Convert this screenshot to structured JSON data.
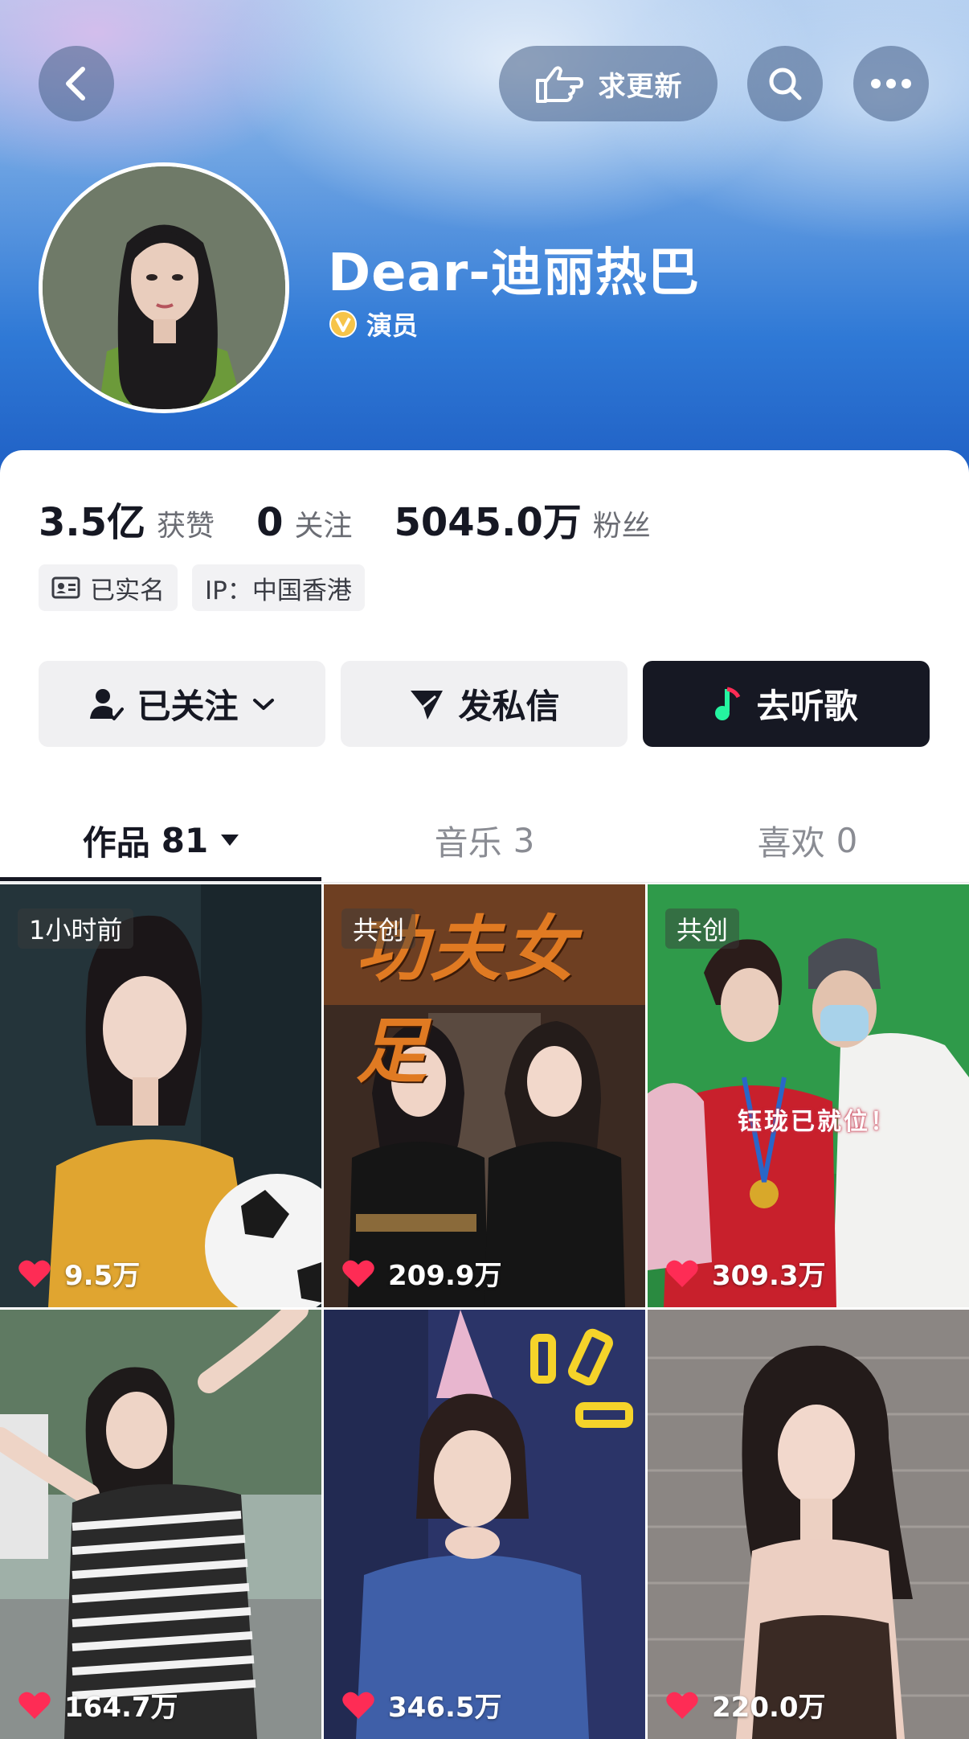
{
  "topbar": {
    "update_label": "求更新"
  },
  "profile": {
    "username": "Dear-迪丽热巴",
    "verify_label": "演员"
  },
  "stats": [
    {
      "value": "3.5亿",
      "label": "获赞"
    },
    {
      "value": "0",
      "label": "关注"
    },
    {
      "value": "5045.0万",
      "label": "粉丝"
    }
  ],
  "tags": [
    {
      "label": "已实名",
      "icon": "id-card-icon"
    },
    {
      "label": "IP：中国香港"
    }
  ],
  "actions": {
    "follow": {
      "label": "已关注",
      "icon": "user-check-icon"
    },
    "message": {
      "label": "发私信",
      "icon": "send-icon"
    },
    "music": {
      "label": "去听歌",
      "icon": "music-note-icon"
    }
  },
  "tabs": [
    {
      "label": "作品",
      "count": "81",
      "active": true
    },
    {
      "label": "音乐",
      "count": "3",
      "active": false
    },
    {
      "label": "喜欢",
      "count": "0",
      "active": false
    }
  ],
  "videos": [
    {
      "badge": "1小时前",
      "likes": "9.5万"
    },
    {
      "badge": "共创",
      "likes": "209.9万",
      "poster_title": "功夫女足"
    },
    {
      "badge": "共创",
      "likes": "309.3万",
      "caption": "钰珑已就位！"
    },
    {
      "badge": "",
      "likes": "164.7万"
    },
    {
      "badge": "",
      "likes": "346.5万"
    },
    {
      "badge": "",
      "likes": "220.0万"
    }
  ],
  "colors": {
    "like_red": "#fe2c55",
    "dark": "#161823",
    "music_green": "#25f4a0"
  }
}
